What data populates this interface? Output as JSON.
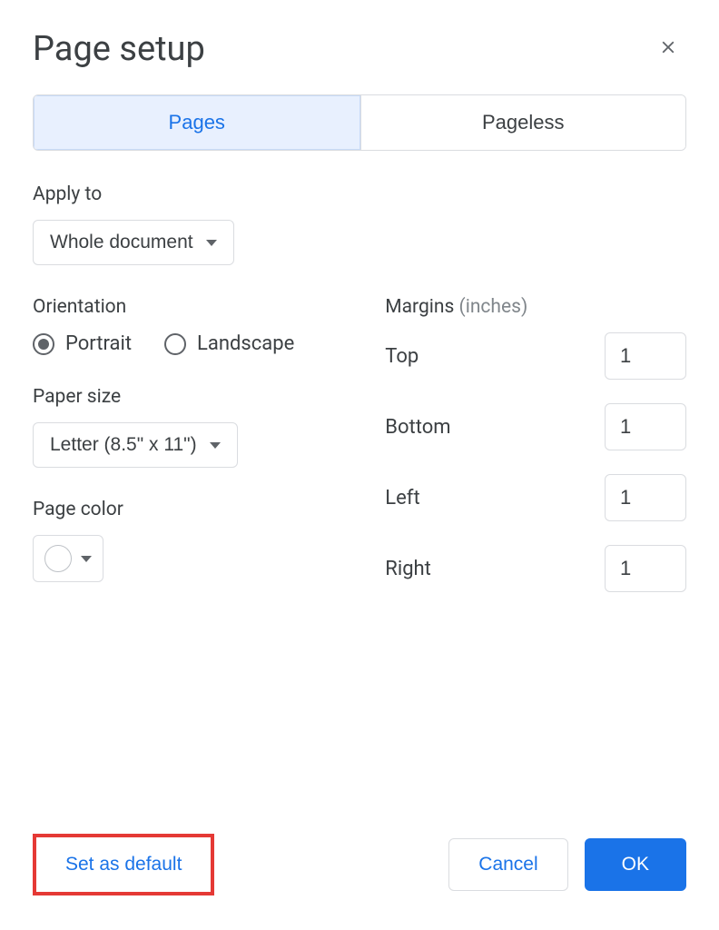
{
  "dialog": {
    "title": "Page setup"
  },
  "tabs": {
    "pages": "Pages",
    "pageless": "Pageless"
  },
  "apply": {
    "label": "Apply to",
    "value": "Whole document"
  },
  "orientation": {
    "label": "Orientation",
    "portrait": "Portrait",
    "landscape": "Landscape",
    "selected": "portrait"
  },
  "paper": {
    "label": "Paper size",
    "value": "Letter (8.5\" x 11\")"
  },
  "pagecolor": {
    "label": "Page color",
    "value": "#ffffff"
  },
  "margins": {
    "label": "Margins",
    "hint": "(inches)",
    "top_label": "Top",
    "bottom_label": "Bottom",
    "left_label": "Left",
    "right_label": "Right",
    "top": "1",
    "bottom": "1",
    "left": "1",
    "right": "1"
  },
  "buttons": {
    "set_default": "Set as default",
    "cancel": "Cancel",
    "ok": "OK"
  }
}
